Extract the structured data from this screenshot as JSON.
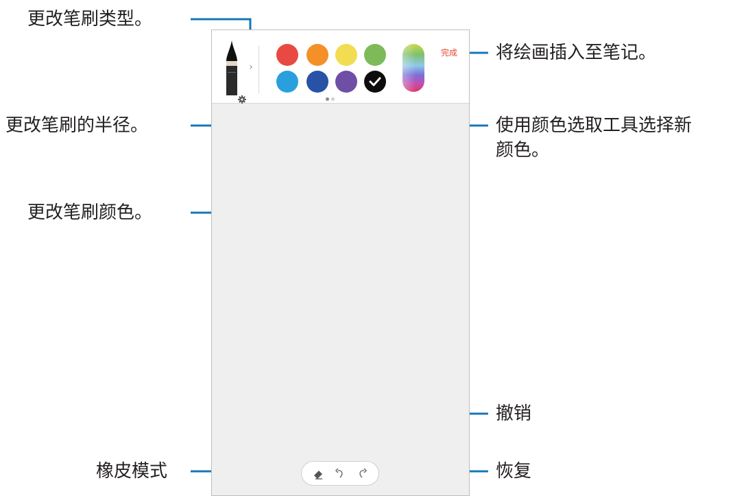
{
  "callouts": {
    "brush_type": "更改笔刷类型。",
    "brush_size": "更改笔刷的半径。",
    "brush_color": "更改笔刷颜色。",
    "insert": "将绘画插入至笔记。",
    "picker_line1": "使用颜色选取工具选择新",
    "picker_line2": "颜色。",
    "undo": "撤销",
    "eraser": "橡皮模式",
    "redo": "恢复"
  },
  "toolbar": {
    "done_label": "完成",
    "brush_icon": "pen-brush-icon",
    "chevron_icon": "chevron-right-icon",
    "gear_icon": "gear-icon",
    "picker_icon": "color-picker-icon",
    "selected_icon": "checkmark-icon"
  },
  "swatches": [
    {
      "name": "red",
      "color": "#e84a43"
    },
    {
      "name": "orange",
      "color": "#f39028"
    },
    {
      "name": "yellow",
      "color": "#f2dd52"
    },
    {
      "name": "green",
      "color": "#7fba5a"
    },
    {
      "name": "light-blue",
      "color": "#29a0dd"
    },
    {
      "name": "blue",
      "color": "#2852a6"
    },
    {
      "name": "purple",
      "color": "#6f4ea6"
    },
    {
      "name": "black",
      "color": "#0d0d0d",
      "selected": true
    }
  ],
  "bottom_tools": {
    "eraser_icon": "eraser-icon",
    "undo_icon": "undo-icon",
    "redo_icon": "redo-icon"
  },
  "colors": {
    "accent": "#e8452c",
    "leader_line": "#1676b7",
    "canvas": "#efefef"
  }
}
